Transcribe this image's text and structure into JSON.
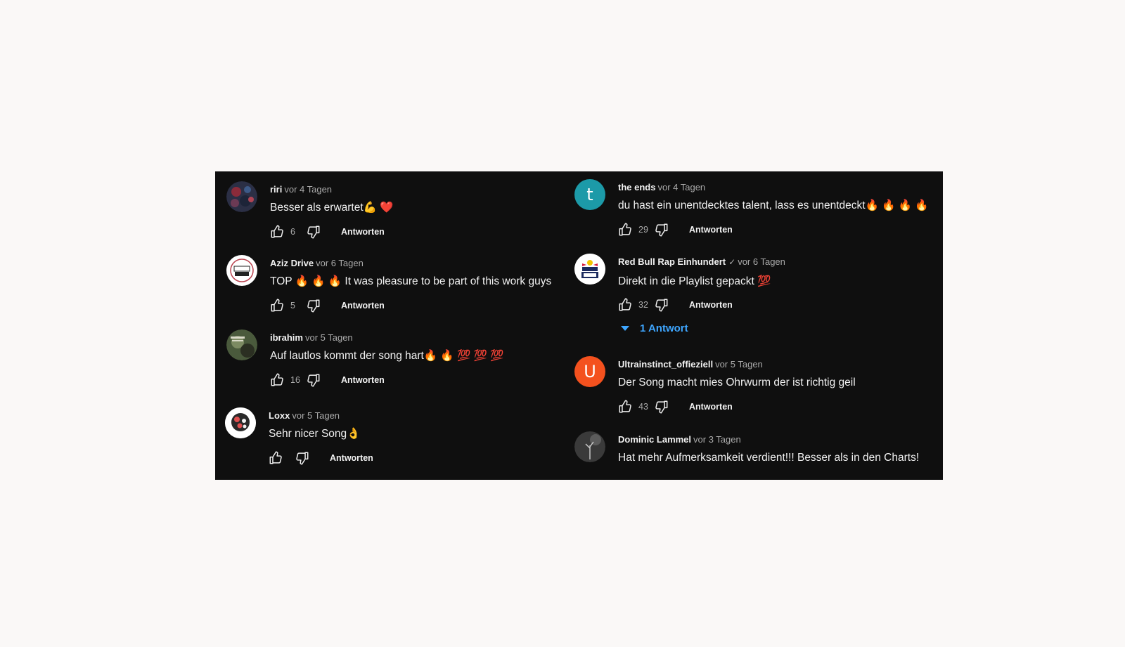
{
  "comments": [
    {
      "author": "riri",
      "time": "vor 4 Tagen",
      "text": "Besser als erwartet💪 ❤️",
      "likes": "6",
      "reply": "Antworten",
      "avatar": "riri-avatar"
    },
    {
      "author": "Aziz Drive",
      "time": "vor 6 Tagen",
      "text": "TOP 🔥 🔥 🔥  It was pleasure to be part of this work guys",
      "likes": "5",
      "reply": "Antworten",
      "avatar": "aziz-drive-logo"
    },
    {
      "author": "ibrahim",
      "time": "vor 5 Tagen",
      "text": "Auf lautlos kommt der song hart🔥 🔥 💯 💯 💯",
      "likes": "16",
      "reply": "Antworten",
      "avatar": "ibrahim-avatar"
    },
    {
      "author": "Loxx",
      "time": "vor 5 Tagen",
      "text": "Sehr nicer Song👌",
      "likes": "",
      "reply": "Antworten",
      "avatar": "loxx-avatar"
    },
    {
      "author": "the ends",
      "time": "vor 4 Tagen",
      "text": "du hast ein unentdecktes talent, lass es unentdeckt🔥 🔥 🔥 🔥",
      "likes": "29",
      "reply": "Antworten",
      "avatar_letter": "t",
      "avatar_color": "#1c9aa8"
    },
    {
      "author": "Red Bull Rap Einhundert",
      "time": "vor 6 Tagen",
      "verified_icon": "✓",
      "text": "Direkt in die Playlist gepackt 💯",
      "likes": "32",
      "reply": "Antworten",
      "replies": "1 Antwort",
      "avatar": "red-bull-rap-100-logo"
    },
    {
      "author": "Ultrainstinct_offieziell",
      "time": "vor 5 Tagen",
      "text": "Der Song macht mies Ohrwurm der ist richtig geil",
      "likes": "43",
      "reply": "Antworten",
      "avatar_letter": "U",
      "avatar_color": "#f4511e"
    },
    {
      "author": "Dominic Lammel",
      "time": "vor 3 Tagen",
      "text": "Hat mehr Aufmerksamkeit verdient!!! Besser als in den Charts!",
      "avatar": "dominic-lammel-avatar"
    }
  ],
  "colors": {
    "panel_bg": "#0f0f0f",
    "link_blue": "#3ea6ff",
    "meta_gray": "#aaaaaa"
  },
  "icons": [
    "like-icon",
    "dislike-icon",
    "expand-triangle-icon",
    "verified-check-icon"
  ]
}
